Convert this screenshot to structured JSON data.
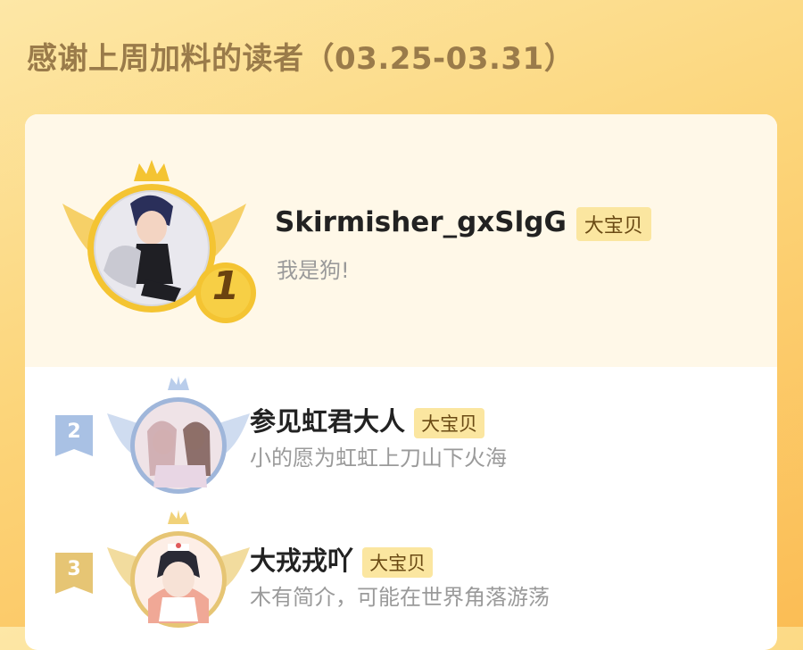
{
  "header": {
    "title": "感谢上周加料的读者（03.25-03.31）"
  },
  "accent_colors": {
    "gold": "#f4c432",
    "silver": "#9fb6da",
    "bronze": "#e6c574",
    "badge_bg": "#fbe6a0"
  },
  "readers": [
    {
      "rank": "1",
      "name": "Skirmisher_gxSlgG",
      "badge": "大宝贝",
      "bio": "我是狗!",
      "frame": "gold-winged-crown"
    },
    {
      "rank": "2",
      "name": "参见虹君大人",
      "badge": "大宝贝",
      "bio": "小的愿为虹虹上刀山下火海",
      "frame": "silver-winged-crown"
    },
    {
      "rank": "3",
      "name": "大戎戎吖",
      "badge": "大宝贝",
      "bio": "木有简介，可能在世界角落游荡",
      "frame": "bronze-winged-crown"
    }
  ]
}
